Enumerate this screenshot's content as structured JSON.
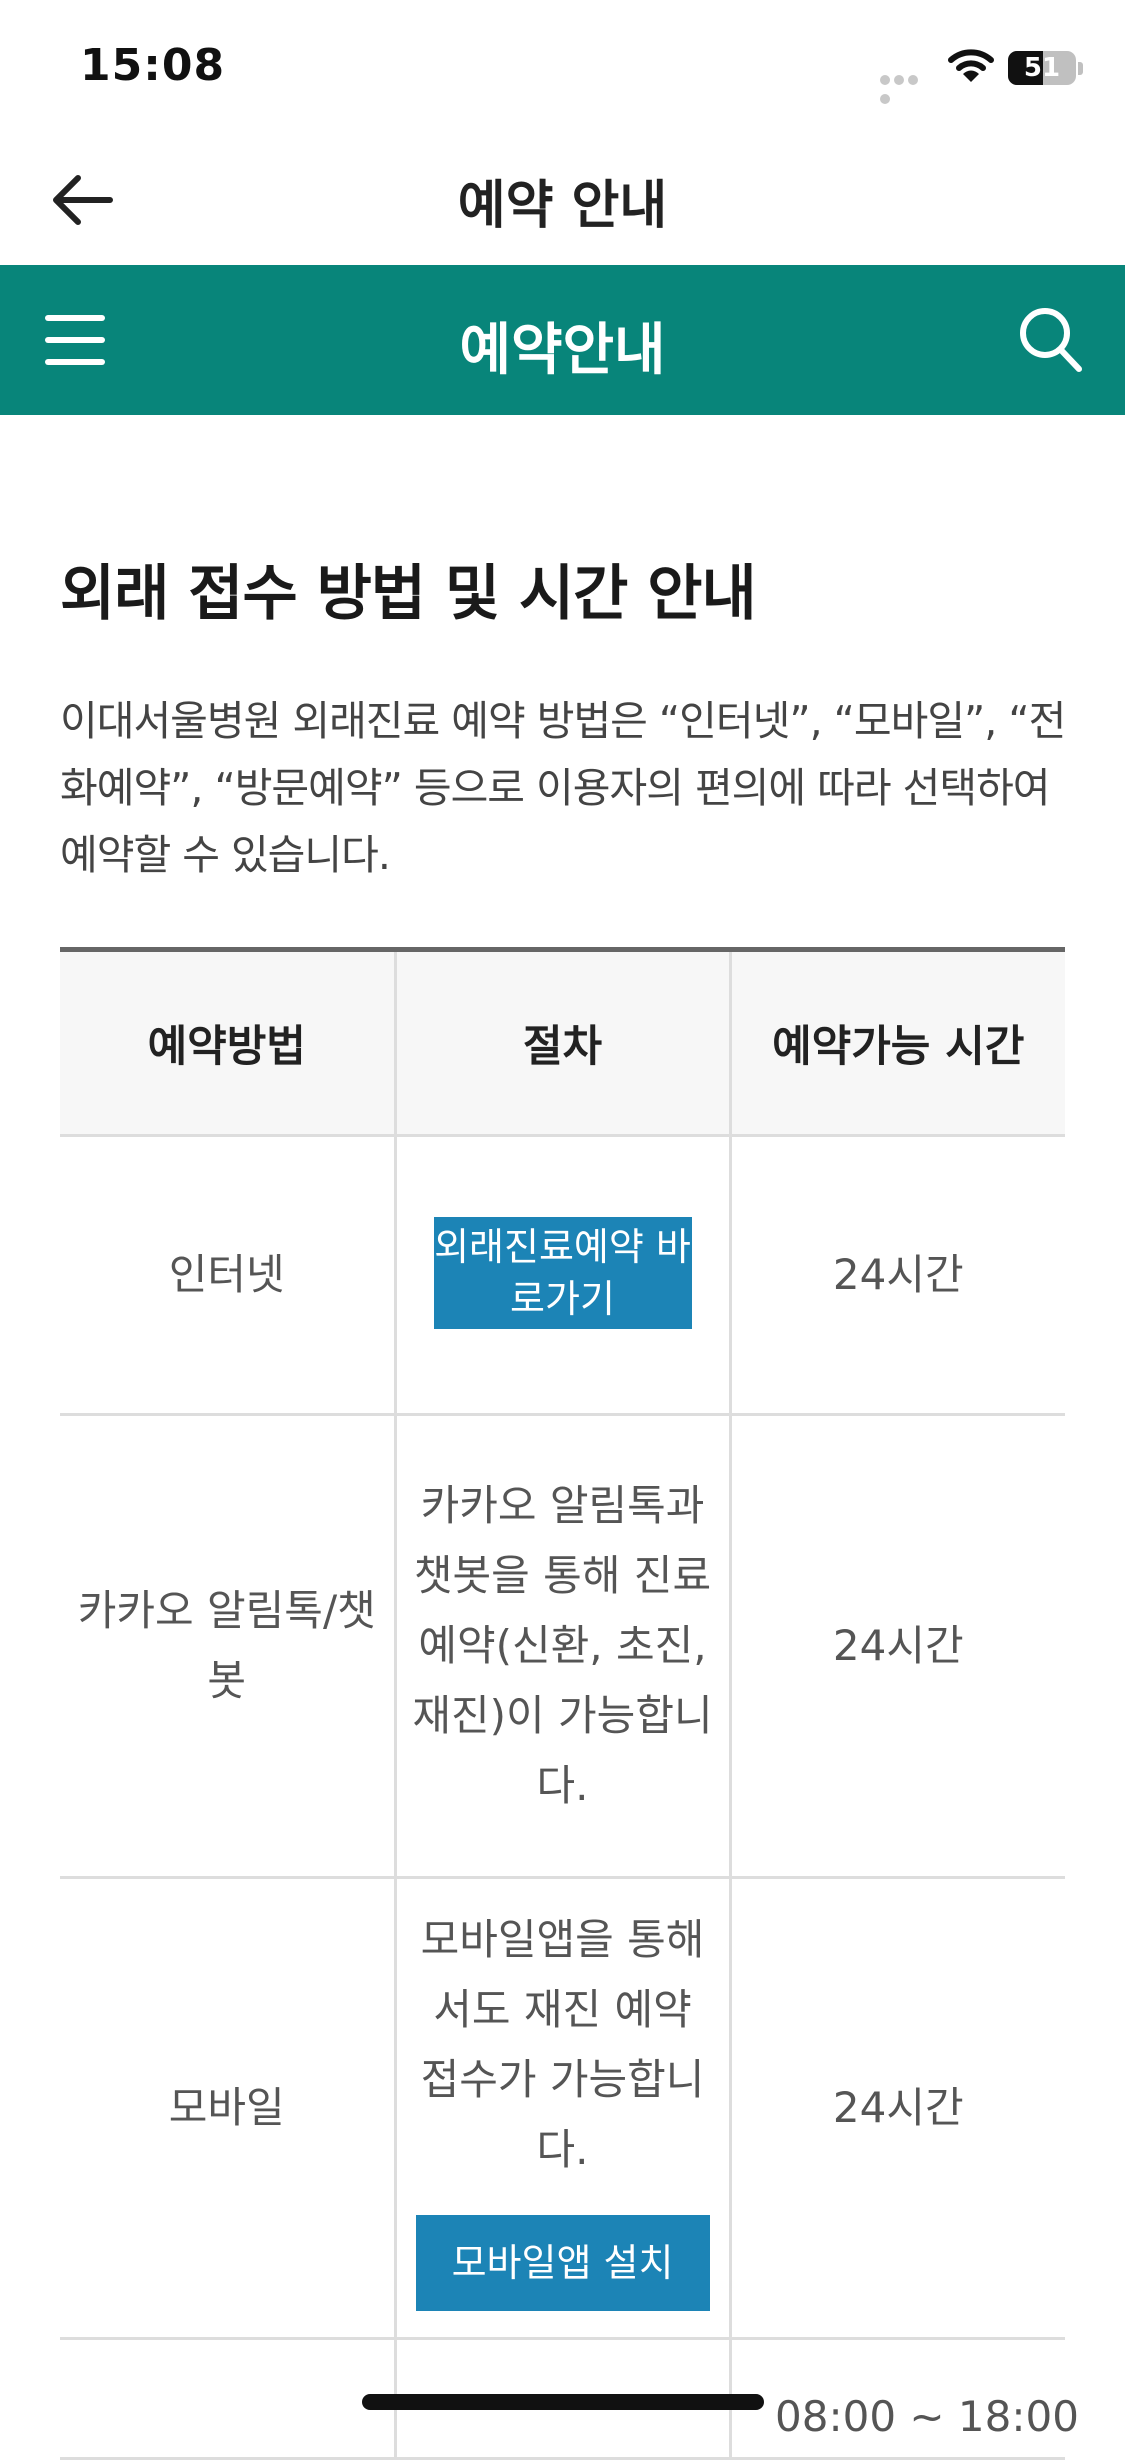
{
  "status_bar": {
    "time": "15:08",
    "battery_level": "51",
    "battery_fraction": 0.51
  },
  "title_bar": {
    "title": "예약 안내",
    "back_icon": "arrow-left-icon"
  },
  "header": {
    "title": "예약안내",
    "menu_icon": "hamburger-menu-icon",
    "search_icon": "search-icon",
    "color": "#08857a"
  },
  "content": {
    "section_title": "외래 접수 방법 및 시간 안내",
    "intro": "이대서울병원 외래진료 예약 방법은 “인터넷”, “모바일”, “전화예약”, “방문예약” 등으로 이용자의 편의에 따라 선택하여 예약할 수 있습니다.",
    "table": {
      "headers": [
        "예약방법",
        "절차",
        "예약가능 시간"
      ],
      "rows": [
        {
          "method": "인터넷",
          "procedure_button": "외래진료예약 바로가기",
          "time": "24시간"
        },
        {
          "method": "카카오 알림톡/챗봇",
          "procedure": "카카오 알림톡과 챗봇을 통해 진료예약(신환, 초진, 재진)이 가능합니다.",
          "time": "24시간"
        },
        {
          "method": "모바일",
          "procedure": "모바일앱을 통해서도 재진 예약 접수가 가능합니다.",
          "procedure_button": "모바일앱 설치",
          "time": "24시간"
        }
      ],
      "next_row_time_partial": "08:00 ~ 18:00"
    },
    "button_color": "#1c84b6"
  }
}
